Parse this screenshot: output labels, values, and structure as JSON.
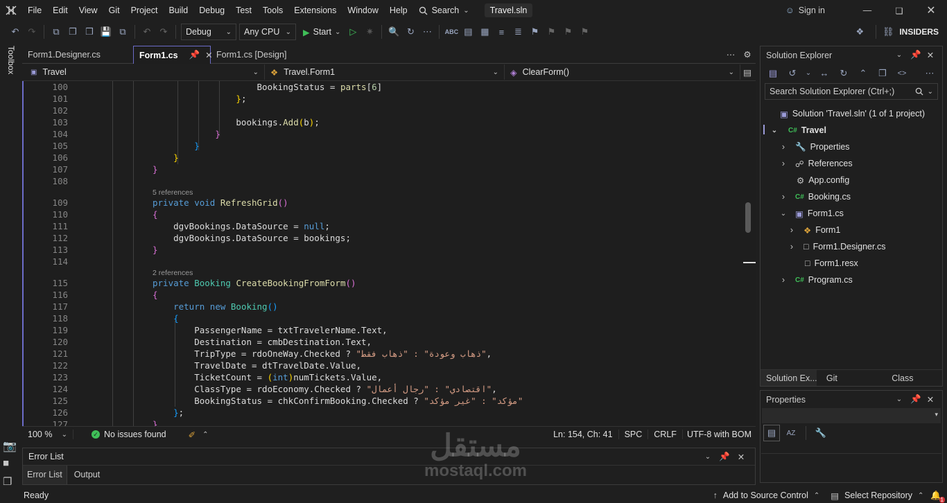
{
  "menubar": {
    "items": [
      "File",
      "Edit",
      "View",
      "Git",
      "Project",
      "Build",
      "Debug",
      "Test",
      "Tools",
      "Extensions",
      "Window",
      "Help"
    ],
    "search_label": "Search",
    "solution_name": "Travel.sln",
    "sign_in": "Sign in"
  },
  "toolbar": {
    "config": "Debug",
    "platform": "Any CPU",
    "start": "Start",
    "insiders": "INSIDERS"
  },
  "left_strip": {
    "toolbox": "Toolbox"
  },
  "tabs": [
    {
      "label": "Form1.Designer.cs"
    },
    {
      "label": "Form1.cs"
    },
    {
      "label": "Form1.cs [Design]"
    }
  ],
  "navbar": {
    "project": "Travel",
    "class": "Travel.Form1",
    "member": "ClearForm()"
  },
  "code_lines": [
    {
      "n": "100",
      "html": "                    BookingStatus = <span class='me'>parts</span>[<span class='nu'>6</span>]"
    },
    {
      "n": "101",
      "html": "                <span class='b1'>}</span>;"
    },
    {
      "n": "102",
      "html": ""
    },
    {
      "n": "103",
      "html": "                bookings.<span class='me'>Add</span><span class='b1'>(</span>b<span class='b1'>)</span>;"
    },
    {
      "n": "104",
      "html": "            <span class='b2'>}</span>"
    },
    {
      "n": "105",
      "html": "        <span class='b3'>}</span>"
    },
    {
      "n": "106",
      "html": "    <span class='b1'>}</span>"
    },
    {
      "n": "107",
      "html": "<span class='b2'>}</span>"
    },
    {
      "n": "108",
      "html": ""
    },
    {
      "n": "109",
      "lens": "5 references",
      "html": "<span class='kw'>private</span> <span class='kw'>void</span> <span class='me'>RefreshGrid</span><span class='b2'>()</span>"
    },
    {
      "n": "110",
      "html": "<span class='b2'>{</span>"
    },
    {
      "n": "111",
      "html": "    dgvBookings.DataSource = <span class='kw'>null</span>;"
    },
    {
      "n": "112",
      "html": "    dgvBookings.DataSource = bookings;"
    },
    {
      "n": "113",
      "html": "<span class='b2'>}</span>"
    },
    {
      "n": "114",
      "html": ""
    },
    {
      "n": "115",
      "lens": "2 references",
      "html": "<span class='kw'>private</span> <span class='ty'>Booking</span> <span class='me'>CreateBookingFromForm</span><span class='b2'>()</span>"
    },
    {
      "n": "116",
      "html": "<span class='b2'>{</span>"
    },
    {
      "n": "117",
      "html": "    <span class='kw'>return</span> <span class='kw'>new</span> <span class='ty'>Booking</span><span class='b3'>()</span>"
    },
    {
      "n": "118",
      "html": "    <span class='b3'>{</span>"
    },
    {
      "n": "119",
      "html": "        PassengerName = txtTravelerName.Text,"
    },
    {
      "n": "120",
      "html": "        Destination = cmbDestination.Text,"
    },
    {
      "n": "121",
      "html": "        TripType = rdoOneWay.Checked ? <span class='st'>\"ذهاب وعودة\" : \"ذهاب فقط\"</span>,"
    },
    {
      "n": "122",
      "html": "        TravelDate = dtTravelDate.Value,"
    },
    {
      "n": "123",
      "html": "        TicketCount = <span class='b1'>(</span><span class='kw'>int</span><span class='b1'>)</span>numTickets.Value,"
    },
    {
      "n": "124",
      "html": "        ClassType = rdoEconomy.Checked ? <span class='st'>\"اقتصادي\" : \"رجال أعمال\"</span>,"
    },
    {
      "n": "125",
      "html": "        BookingStatus = chkConfirmBooking.Checked ? <span class='st'>\"مؤكد\" : \"غير مؤكد\"</span>"
    },
    {
      "n": "126",
      "html": "    <span class='b3'>}</span>;"
    },
    {
      "n": "127",
      "html": "<span class='b2'>}</span>"
    }
  ],
  "editor_status": {
    "zoom": "100 %",
    "issues": "No issues found",
    "position": "Ln: 154, Ch: 41",
    "spacing": "SPC",
    "eol": "CRLF",
    "encoding": "UTF-8 with BOM"
  },
  "error_list": {
    "title": "Error List",
    "tabs": [
      "Error List",
      "Output"
    ]
  },
  "solution_explorer": {
    "title": "Solution Explorer",
    "search_placeholder": "Search Solution Explorer (Ctrl+;)",
    "nodes": [
      {
        "label": "Solution 'Travel.sln' (1 of 1 project)"
      },
      {
        "label": "Travel"
      },
      {
        "label": "Properties"
      },
      {
        "label": "References"
      },
      {
        "label": "App.config"
      },
      {
        "label": "Booking.cs"
      },
      {
        "label": "Form1.cs"
      },
      {
        "label": "Form1"
      },
      {
        "label": "Form1.Designer.cs"
      },
      {
        "label": "Form1.resx"
      },
      {
        "label": "Program.cs"
      }
    ],
    "bottom_tabs": [
      "Solution Ex...",
      "Git Changes",
      "Class View"
    ]
  },
  "properties": {
    "title": "Properties"
  },
  "statusbar": {
    "ready": "Ready",
    "source_control": "Add to Source Control",
    "repository": "Select Repository",
    "notifications": "1"
  },
  "watermark": {
    "arabic": "مستقل",
    "latin": "mostaql.com"
  },
  "colors": {
    "accent": "#6c6cc8",
    "background": "#1f1f1f",
    "editor": "#1e1e1e"
  }
}
